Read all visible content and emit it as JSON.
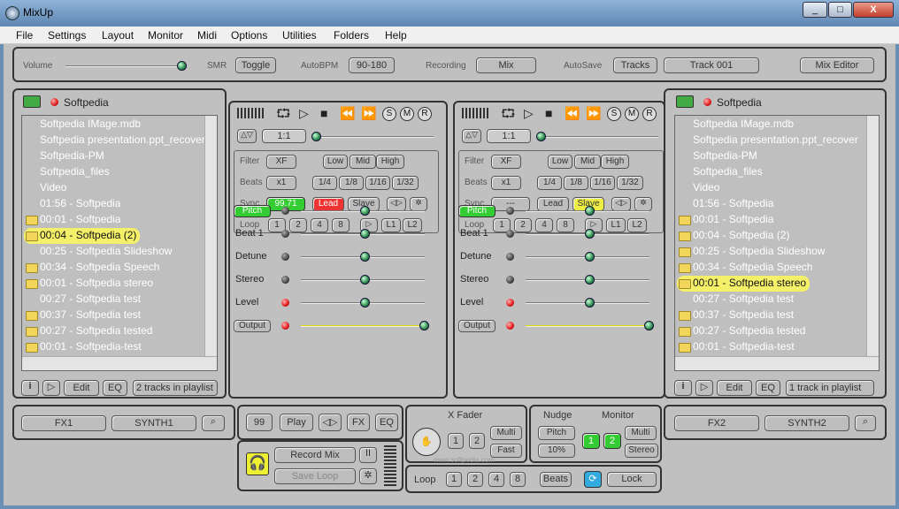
{
  "window": {
    "title": "MixUp",
    "min": "_",
    "max": "□",
    "close": "X"
  },
  "menu": [
    "File",
    "Settings",
    "Layout",
    "Monitor",
    "Midi",
    "Options",
    "Utilities",
    "Folders",
    "Help"
  ],
  "top": {
    "volume_label": "Volume",
    "smr_label": "SMR",
    "toggle": "Toggle",
    "autobpm_label": "AutoBPM",
    "autobpm_value": "90-180",
    "recording_label": "Recording",
    "mix": "Mix",
    "autosave_label": "AutoSave",
    "tracks": "Tracks",
    "track_name": "Track 001",
    "mix_editor": "Mix Editor",
    "volume_level": 0.97
  },
  "left_browser": {
    "title": "Softpedia",
    "items": [
      {
        "t": "Softpedia IMage.mdb",
        "f": false
      },
      {
        "t": "Softpedia presentation.ppt_recover",
        "f": false
      },
      {
        "t": "Softpedia-PM",
        "f": false
      },
      {
        "t": "Softpedia_files",
        "f": false
      },
      {
        "t": "Video",
        "f": false
      },
      {
        "t": "01:56 - Softpedia",
        "f": false
      },
      {
        "t": "00:01 - Softpedia",
        "f": true
      },
      {
        "t": "00:04 - Softpedia (2)",
        "f": true,
        "hl": true
      },
      {
        "t": "00:25 - Softpedia Slideshow",
        "f": false
      },
      {
        "t": "00:34 - Softpedia Speech",
        "f": true
      },
      {
        "t": "00:01 - Softpedia stereo",
        "f": true
      },
      {
        "t": "00:27 - Softpedia test",
        "f": false
      },
      {
        "t": "00:37 - Softpedia test",
        "f": true
      },
      {
        "t": "00:27 - Softpedia tested",
        "f": true
      },
      {
        "t": "00:01 - Softpedia-test",
        "f": true
      }
    ],
    "footer": {
      "edit": "Edit",
      "eq": "EQ",
      "status": "2 tracks in playlist"
    }
  },
  "right_browser": {
    "title": "Softpedia",
    "items": [
      {
        "t": "Softpedia IMage.mdb",
        "f": false
      },
      {
        "t": "Softpedia presentation.ppt_recover",
        "f": false
      },
      {
        "t": "Softpedia-PM",
        "f": false
      },
      {
        "t": "Softpedia_files",
        "f": false
      },
      {
        "t": "Video",
        "f": false
      },
      {
        "t": "01:56 - Softpedia",
        "f": false
      },
      {
        "t": "00:01 - Softpedia",
        "f": true
      },
      {
        "t": "00:04 - Softpedia (2)",
        "f": true
      },
      {
        "t": "00:25 - Softpedia Slideshow",
        "f": true
      },
      {
        "t": "00:34 - Softpedia Speech",
        "f": true
      },
      {
        "t": "00:01 - Softpedia stereo",
        "f": true,
        "hl": true
      },
      {
        "t": "00:27 - Softpedia test",
        "f": false
      },
      {
        "t": "00:37 - Softpedia test",
        "f": true
      },
      {
        "t": "00:27 - Softpedia tested",
        "f": true
      },
      {
        "t": "00:01 - Softpedia-test",
        "f": true
      }
    ],
    "footer": {
      "edit": "Edit",
      "eq": "EQ",
      "status": "1 track in playlist"
    }
  },
  "deck_left": {
    "ratio": "1:1",
    "filter_label": "Filter",
    "xf": "XF",
    "low": "Low",
    "mid": "Mid",
    "high": "High",
    "beats_label": "Beats",
    "x1": "x1",
    "b1": "1/4",
    "b2": "1/8",
    "b3": "1/16",
    "b4": "1/32",
    "sync_label": "Sync",
    "bpm": "99.71",
    "lead": "Lead",
    "slave": "Slave",
    "loop_label": "Loop",
    "l1": "1",
    "l2": "2",
    "l3": "4",
    "l4": "8",
    "L1": "L1",
    "L2": "L2",
    "pitch": "Pitch",
    "beat1": "Beat 1",
    "detune": "Detune",
    "stereo": "Stereo",
    "level": "Level",
    "output": "Output",
    "s": "S",
    "m": "M",
    "r": "R"
  },
  "deck_right": {
    "ratio": "1:1",
    "filter_label": "Filter",
    "xf": "XF",
    "low": "Low",
    "mid": "Mid",
    "high": "High",
    "beats_label": "Beats",
    "x1": "x1",
    "b1": "1/4",
    "b2": "1/8",
    "b3": "1/16",
    "b4": "1/32",
    "sync_label": "Sync",
    "bpm": "---",
    "lead": "Lead",
    "slave": "Slave",
    "loop_label": "Loop",
    "l1": "1",
    "l2": "2",
    "l3": "4",
    "l4": "8",
    "L1": "L1",
    "L2": "L2",
    "pitch": "Pitch",
    "beat1": "Beat 1",
    "detune": "Detune",
    "stereo": "Stereo",
    "level": "Level",
    "output": "Output",
    "s": "S",
    "m": "M",
    "r": "R"
  },
  "bottom": {
    "fx1": "FX1",
    "synth1": "SYNTH1",
    "fx2": "FX2",
    "synth2": "SYNTH2",
    "num": "99",
    "play": "Play",
    "fx": "FX",
    "eq": "EQ",
    "record_mix": "Record Mix",
    "save_loop": "Save Loop",
    "xfader": "X Fader",
    "x1": "1",
    "x2": "2",
    "multi": "Multi",
    "fast": "Fast",
    "nudge": "Nudge",
    "monitor": "Monitor",
    "pitch": "Pitch",
    "percent": "10%",
    "m1": "1",
    "m2": "2",
    "mmulti": "Multi",
    "mstereo": "Stereo",
    "loop_label": "Loop",
    "lp1": "1",
    "lp2": "2",
    "lp4": "4",
    "lp8": "8",
    "beats": "Beats",
    "lock": "Lock",
    "watermark": "www.softpedia.com"
  },
  "colors": {
    "accent_green": "#33cc33",
    "lead_red": "#e33333",
    "slave_yellow": "#eeee44",
    "highlight": "#f5f06a"
  }
}
